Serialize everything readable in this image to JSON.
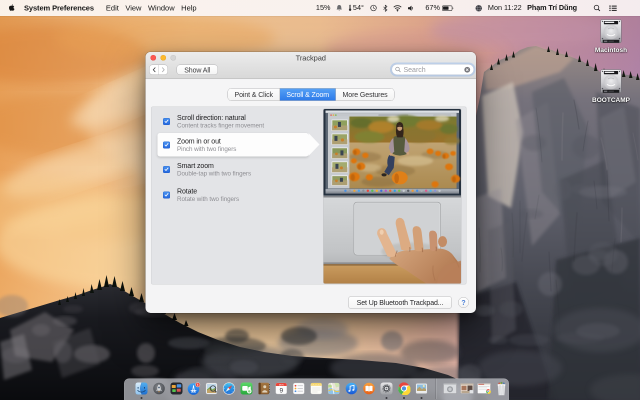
{
  "menu_bar": {
    "apple_icon": "apple-icon",
    "menus": {
      "app": "System Preferences",
      "m1": "Edit",
      "m2": "View",
      "m3": "Window",
      "m4": "Help"
    },
    "status": {
      "percent_left": "15%",
      "bell_icon": "bell-icon",
      "temperature": "54°",
      "time_machine_icon": "time-machine-icon",
      "bluetooth_icon": "bluetooth-icon",
      "wifi_icon": "wifi-icon",
      "volume_icon": "volume-icon",
      "battery_percent": "67%",
      "battery_icon": "battery-icon",
      "globe_icon": "globe-icon",
      "clock": "Mon 11:22",
      "user_name": "Phạm Trí Dũng",
      "spotlight_icon": "spotlight-icon",
      "notification_center_icon": "notification-center-icon"
    }
  },
  "desktop_icons": {
    "macintosh": {
      "label": "Macintosh",
      "icon": "hard-drive-icon"
    },
    "bootcamp": {
      "label": "BOOTCAMP",
      "icon": "hard-drive-icon"
    }
  },
  "window": {
    "title": "Trackpad",
    "toolbar": {
      "show_all": "Show All",
      "search_placeholder": "Search"
    },
    "tabs": [
      {
        "label": "Point & Click",
        "selected": false
      },
      {
        "label": "Scroll & Zoom",
        "selected": true
      },
      {
        "label": "More Gestures",
        "selected": false
      }
    ],
    "settings": [
      {
        "title": "Scroll direction: natural",
        "subtitle": "Content tracks finger movement",
        "checked": true,
        "selected": false
      },
      {
        "title": "Zoom in or out",
        "subtitle": "Pinch with two fingers",
        "checked": true,
        "selected": true
      },
      {
        "title": "Smart zoom",
        "subtitle": "Double-tap with two fingers",
        "checked": true,
        "selected": false
      },
      {
        "title": "Rotate",
        "subtitle": "Rotate with two fingers",
        "checked": true,
        "selected": false
      }
    ],
    "footer": {
      "setup_button": "Set Up Bluetooth Trackpad...",
      "help_button": "?"
    }
  },
  "dock": {
    "items": [
      "finder",
      "launchpad",
      "mission-control",
      "app-store",
      "preview",
      "safari",
      "facetime",
      "contacts",
      "calendar",
      "reminders",
      "notes",
      "maps",
      "itunes",
      "ibooks",
      "system-preferences",
      "chrome",
      "photos"
    ],
    "running": [
      "finder",
      "system-preferences",
      "chrome",
      "photos"
    ],
    "minimized_windows": 3,
    "trash": "trash-full-icon"
  },
  "colors": {
    "selected_tab_blue": "#3b85ee",
    "checkbox_blue": "#2e73e6",
    "help_blue": "#4a7fd6"
  }
}
